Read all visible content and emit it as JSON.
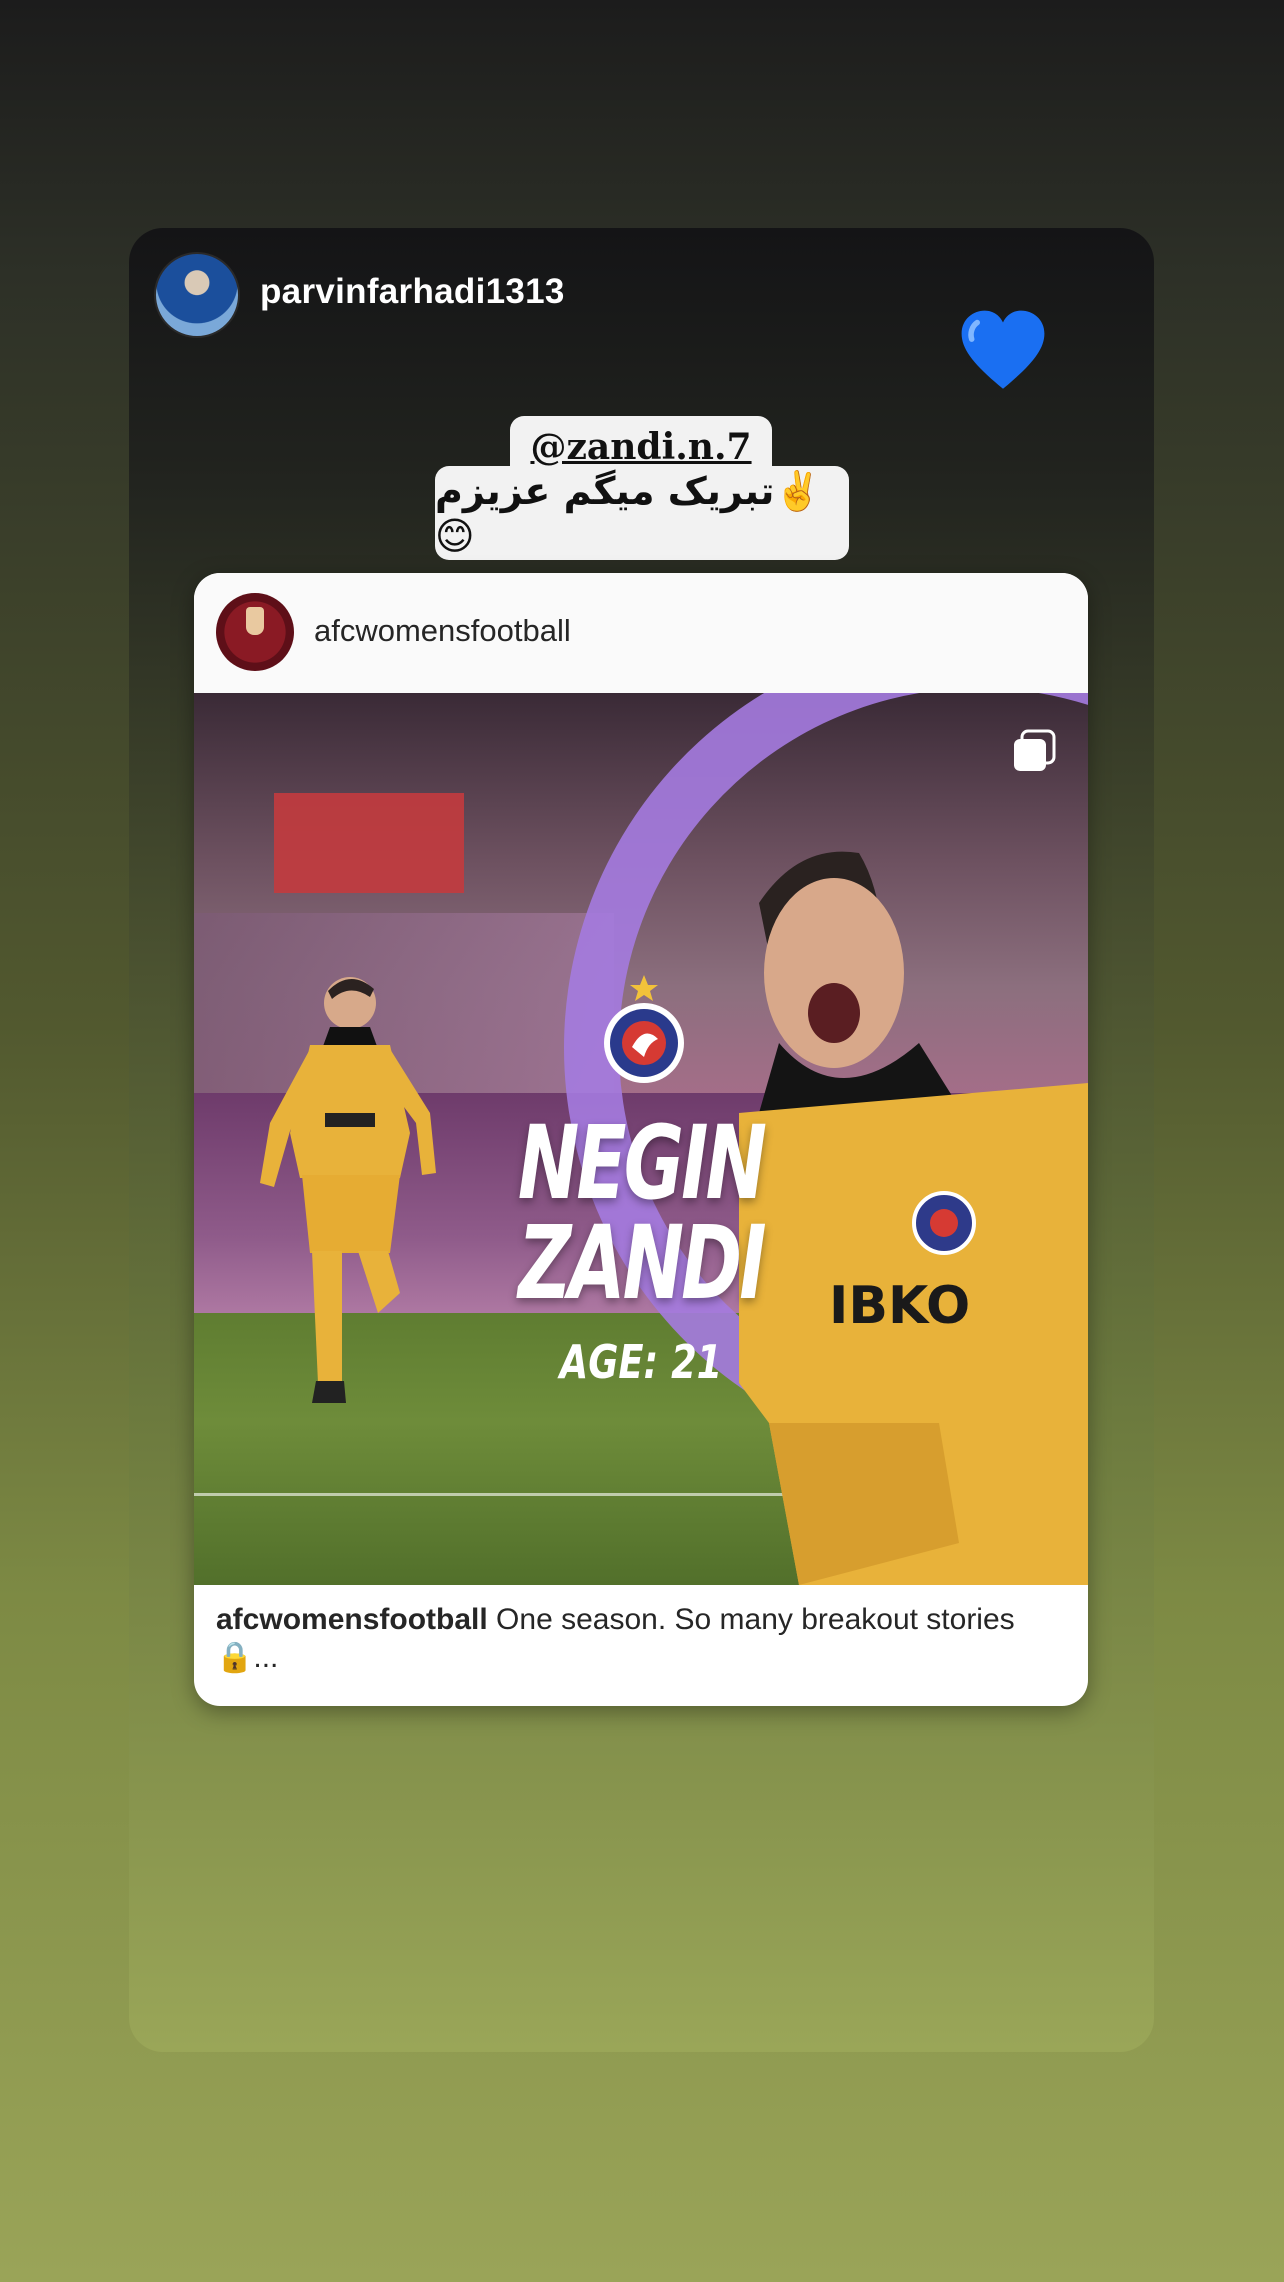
{
  "story": {
    "author": "parvinfarhadi1313",
    "mention": "@zandi.n.7",
    "caption_text": "تبریک میگم عزیزم✌️😊",
    "heart_sticker": "blue-heart-icon"
  },
  "post": {
    "username": "afcwomensfootball",
    "image": {
      "name_line1": "NEGIN",
      "name_line2": "ZANDI",
      "age": "AGE: 21"
    },
    "caption_user": "afcwomensfootball",
    "caption_text": "One season. So many breakout stories 🔒...",
    "carousel_icon": "multiple-images-icon"
  },
  "colors": {
    "accent_purple": "#a57be0",
    "kit_yellow": "#e8b23a",
    "heart_blue": "#1a6ff2"
  }
}
